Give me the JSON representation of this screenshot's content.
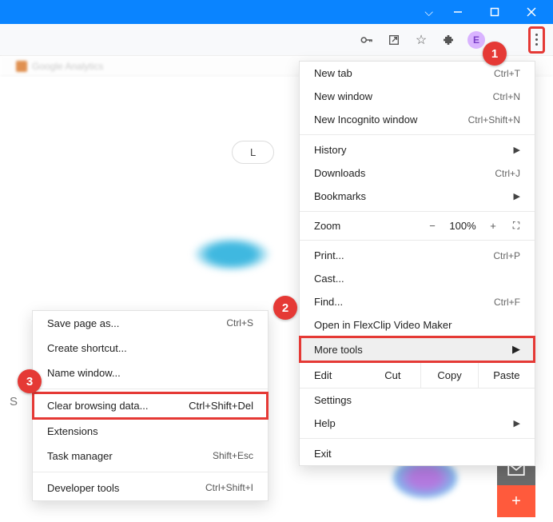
{
  "titlebar": {
    "chevron": "⌵"
  },
  "toolbar": {
    "avatar_letter": "E"
  },
  "tabbar": {
    "blur_text": "Google Analytics"
  },
  "page": {
    "pill_label": "L"
  },
  "menu": {
    "new_tab": "New tab",
    "new_tab_sc": "Ctrl+T",
    "new_window": "New window",
    "new_window_sc": "Ctrl+N",
    "new_incog": "New Incognito window",
    "new_incog_sc": "Ctrl+Shift+N",
    "history": "History",
    "downloads": "Downloads",
    "downloads_sc": "Ctrl+J",
    "bookmarks": "Bookmarks",
    "zoom_label": "Zoom",
    "zoom_minus": "−",
    "zoom_val": "100%",
    "zoom_plus": "+",
    "print": "Print...",
    "print_sc": "Ctrl+P",
    "cast": "Cast...",
    "find": "Find...",
    "find_sc": "Ctrl+F",
    "flexclip": "Open in FlexClip Video Maker",
    "more_tools": "More tools",
    "edit": "Edit",
    "cut": "Cut",
    "copy": "Copy",
    "paste": "Paste",
    "settings": "Settings",
    "help": "Help",
    "exit": "Exit"
  },
  "submenu": {
    "save_page": "Save page as...",
    "save_page_sc": "Ctrl+S",
    "create_shortcut": "Create shortcut...",
    "name_window": "Name window...",
    "clear_data": "Clear browsing data...",
    "clear_data_sc": "Ctrl+Shift+Del",
    "extensions": "Extensions",
    "task_mgr": "Task manager",
    "task_mgr_sc": "Shift+Esc",
    "dev_tools": "Developer tools",
    "dev_tools_sc": "Ctrl+Shift+I"
  },
  "badges": {
    "b1": "1",
    "b2": "2",
    "b3": "3"
  },
  "side_letter": "S"
}
